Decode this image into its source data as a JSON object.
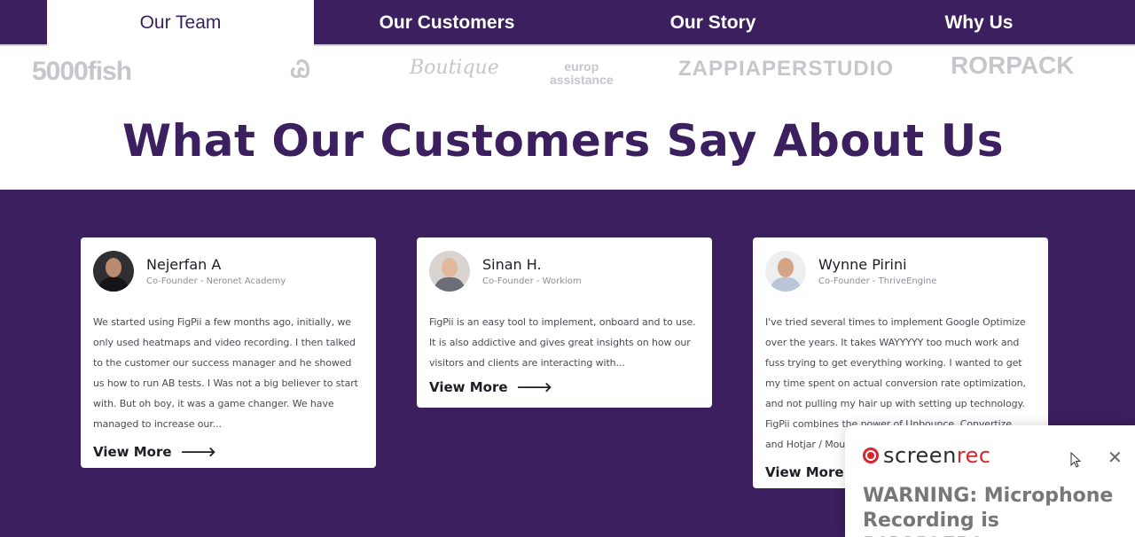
{
  "tabs": [
    {
      "label": "Our Team",
      "active": true
    },
    {
      "label": "Our Customers",
      "active": false
    },
    {
      "label": "Our Story",
      "active": false
    },
    {
      "label": "Why Us",
      "active": false
    }
  ],
  "logos": {
    "logo_1": "5000fish",
    "logo_2": "Ꮚ",
    "logo_3": "Boutique",
    "logo_4": "europ\nassistance",
    "logo_5": "ZAPPIAPERSTUDIO",
    "logo_6": "RORPACK"
  },
  "heading": "What Our Customers Say About Us",
  "testimonials": [
    {
      "name": "Nejerfan A",
      "role": "Co-Founder - Neronet Academy",
      "quote": "We started using FigPii a few months ago, initially, we only used heatmaps and video recording. I then talked to the customer our success manager and he showed us how to run AB tests. I Was not a big believer to start with. But oh boy, it was a game changer. We have managed to increase our...",
      "cta": "View More"
    },
    {
      "name": "Sinan H.",
      "role": "Co-Founder - Workiom",
      "quote": "FigPii is an easy tool to implement, onboard and to use. It is also addictive and gives great insights on how our visitors and clients are interacting with...",
      "cta": "View More"
    },
    {
      "name": "Wynne Pirini",
      "role": "Co-Founder - ThriveEngine",
      "quote": "I've tried several times to implement Google Optimize over the years. It takes WAYYYYY too much work and fuss trying to get everything working. I wanted to get my time spent on actual conversion rate optimization, and not pulling my hair up with setting up technology. FigPii combines the power of Unbounce, Convertize, and Hotjar / Mouseflow into o...",
      "cta": "View More"
    }
  ],
  "popup": {
    "brand_main": "screen",
    "brand_accent": "rec",
    "close": "✕",
    "warning": "WARNING: Microphone Recording is DISABLED!"
  },
  "colors": {
    "brand_purple": "#3b1f5e",
    "rec_red": "#d7262e"
  }
}
